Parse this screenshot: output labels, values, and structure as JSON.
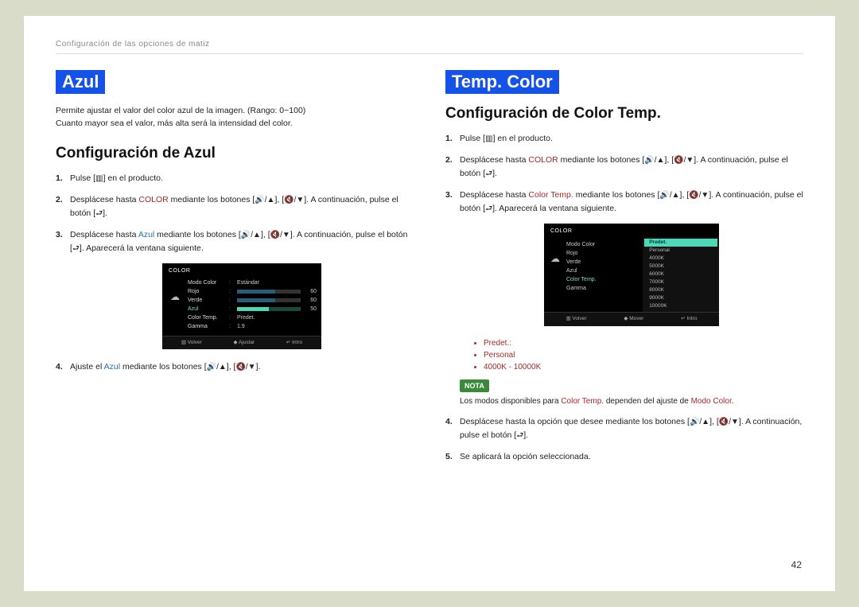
{
  "header": {
    "path": "Configuración de las opciones de matiz"
  },
  "left": {
    "title": "Azul",
    "intro1": "Permite ajustar el valor del color azul de la imagen. (Rango: 0~100)",
    "intro2": "Cuanto mayor sea el valor, más alta será la intensidad del color.",
    "subheading": "Configuración de Azul",
    "step1_a": "Pulse [",
    "step1_b": "] en el producto.",
    "step2_a": "Desplácese hasta ",
    "step2_kw": "COLOR",
    "step2_b": " mediante los botones [",
    "step2_c": "], [",
    "step2_d": "]. A continuación, pulse el botón [",
    "step2_e": "].",
    "step3_a": "Desplácese hasta ",
    "step3_kw": "Azul",
    "step3_b": " mediante los botones [",
    "step3_c": "], [",
    "step3_d": "]. A continuación, pulse el botón [",
    "step3_e": "]. Aparecerá la ventana siguiente.",
    "step4_a": "Ajuste el ",
    "step4_kw": "Azul",
    "step4_b": " mediante los botones [",
    "step4_c": "], [",
    "step4_d": "].",
    "osd": {
      "header": "COLOR",
      "rows": [
        {
          "label": "Modo Color",
          "value": "Estándar"
        },
        {
          "label": "Rojo",
          "value": "60",
          "bar": "fill60"
        },
        {
          "label": "Verde",
          "value": "60",
          "bar": "fill60"
        },
        {
          "label": "Azul",
          "value": "50",
          "bar": "hl"
        },
        {
          "label": "Color Temp.",
          "value": "Predet."
        },
        {
          "label": "Gamma",
          "value": "1.9"
        }
      ],
      "footer": [
        "▥ Volver",
        "◆ Ajustar",
        "↵ Intro"
      ]
    }
  },
  "right": {
    "title": "Temp. Color",
    "subheading": "Configuración de Color Temp.",
    "step1_a": "Pulse [",
    "step1_b": "] en el producto.",
    "step2_a": "Desplácese hasta ",
    "step2_kw": "COLOR",
    "step2_b": " mediante los botones [",
    "step2_c": "], [",
    "step2_d": "]. A continuación, pulse el botón [",
    "step2_e": "].",
    "step3_a": "Desplácese hasta ",
    "step3_kw": "Color Temp.",
    "step3_b": " mediante los botones [",
    "step3_c": "], [",
    "step3_d": "]. A continuación, pulse el botón [",
    "step3_e": "]. Aparecerá la ventana siguiente.",
    "bullets": [
      "Predet.:",
      "Personal",
      "4000K - 10000K"
    ],
    "nota_label": "NOTA",
    "nota_a": "Los modos disponibles para ",
    "nota_kw1": "Color Temp.",
    "nota_b": " dependen del ajuste de ",
    "nota_kw2": "Modo Color",
    "nota_c": ".",
    "step4_a": "Desplácese hasta la opción que desee mediante los botones [",
    "step4_b": "], [",
    "step4_c": "]. A continuación, pulse el botón [",
    "step4_d": "].",
    "step5": "Se aplicará la opción seleccionada.",
    "osd": {
      "header": "COLOR",
      "left_rows": [
        "Modo Color",
        "Rojo",
        "Verde",
        "Azul",
        "Color Temp.",
        "Gamma"
      ],
      "options": [
        "Predet.",
        "Personal",
        "4000K",
        "5000K",
        "6000K",
        "7000K",
        "8000K",
        "9000K",
        "10000K"
      ],
      "selected": "Predet.",
      "footer": [
        "▥ Volver",
        "◆ Mover",
        "↵ Intro"
      ]
    }
  },
  "glyphs": {
    "menu": "▥",
    "up": "🔊/▲",
    "down": "🔇/▼",
    "enter": "⮐"
  },
  "page_number": "42"
}
